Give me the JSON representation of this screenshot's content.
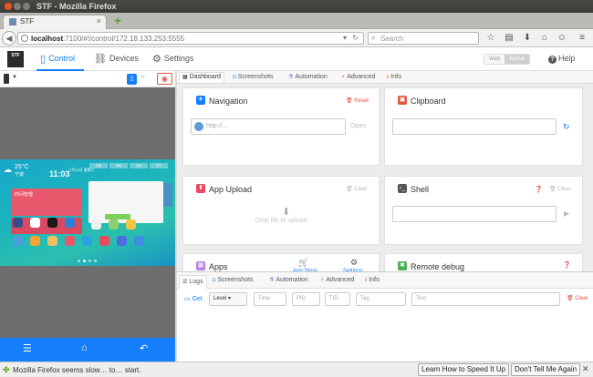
{
  "window": {
    "title": "STF - Mozilla Firefox"
  },
  "browser": {
    "tab_label": "STF",
    "url_host": "localhost",
    "url_path": ":7100/#!/control/172.18.133.253:5555",
    "search_placeholder": "Search"
  },
  "app": {
    "logo_text": "STF",
    "nav": [
      {
        "label": "Control",
        "icon": "phone-icon",
        "active": true
      },
      {
        "label": "Devices",
        "icon": "sitemap-icon",
        "active": false
      },
      {
        "label": "Settings",
        "icon": "gears-icon",
        "active": false
      }
    ],
    "mode_web": "Web",
    "mode_native": "Native",
    "help_label": "Help"
  },
  "device_screen": {
    "temperature": "25°C",
    "city": "宁波",
    "clock": "11:03",
    "date": "7月12日 星期二",
    "widget_label": "时间管理",
    "app_tabs": [
      "日程",
      "号码",
      "日历",
      "天气"
    ]
  },
  "control_tabs": [
    {
      "label": "Dashboard",
      "icon": "dashboard-icon",
      "active": true
    },
    {
      "label": "Screenshots",
      "icon": "camera-icon",
      "active": false
    },
    {
      "label": "Automation",
      "icon": "flask-icon",
      "active": false
    },
    {
      "label": "Advanced",
      "icon": "bolt-icon",
      "active": false
    },
    {
      "label": "Info",
      "icon": "info-icon",
      "active": false
    }
  ],
  "cards": {
    "navigation": {
      "title": "Navigation",
      "action": "Reset",
      "url_placeholder": "http://...",
      "open_label": "Open"
    },
    "clipboard": {
      "title": "Clipboard"
    },
    "app_upload": {
      "title": "App Upload",
      "action": "Clear",
      "drop_text": "Drop file to upload"
    },
    "shell": {
      "title": "Shell",
      "action": "Clear"
    },
    "apps": {
      "title": "Apps",
      "store_label": "App Store",
      "settings_label": "Settings"
    },
    "remote_debug": {
      "title": "Remote debug"
    }
  },
  "logs": {
    "tabs": [
      {
        "label": "Logs",
        "icon": "list-icon",
        "active": true
      },
      {
        "label": "Screenshots",
        "icon": "camera-icon",
        "active": false
      },
      {
        "label": "Automation",
        "icon": "flask-icon",
        "active": false
      },
      {
        "label": "Advanced",
        "icon": "bolt-icon",
        "active": false
      },
      {
        "label": "Info",
        "icon": "info-icon",
        "active": false
      }
    ],
    "get_label": "Get",
    "level_value": "Level",
    "time_placeholder": "Time",
    "pid_placeholder": "PID",
    "tid_placeholder": "TID",
    "tag_placeholder": "Tag",
    "text_placeholder": "Text",
    "clear_label": "Clear"
  },
  "notification": {
    "message": "Mozilla Firefox seems slow… to… start.",
    "learn_button": "Learn How to Speed It Up",
    "dismiss_button": "Don't Tell Me Again"
  },
  "colors": {
    "accent": "#157efb",
    "danger": "#e5533d",
    "ubuntu_orange": "#e95420"
  }
}
